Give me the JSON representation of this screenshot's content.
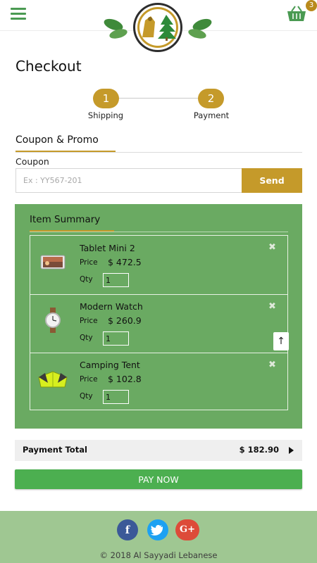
{
  "header": {
    "menu_icon": "hamburger-icon",
    "logo_icon": "al-sayyadi-logo",
    "cart_icon": "basket-icon",
    "cart_count": "3"
  },
  "page": {
    "title": "Checkout"
  },
  "steps": [
    {
      "number": "1",
      "label": "Shipping"
    },
    {
      "number": "2",
      "label": "Payment"
    }
  ],
  "coupon_section": {
    "title": "Coupon & Promo",
    "label": "Coupon",
    "placeholder": "Ex : YY567-201",
    "value": "",
    "send_label": "Send"
  },
  "summary": {
    "title": "Item Summary",
    "price_label": "Price",
    "qty_label": "Qty",
    "items": [
      {
        "name": "Tablet Mini 2",
        "price": "$ 472.5",
        "qty": "1",
        "thumb_icon": "tablet-icon"
      },
      {
        "name": "Modern Watch",
        "price": "$ 260.9",
        "qty": "1",
        "thumb_icon": "watch-icon"
      },
      {
        "name": "Camping Tent",
        "price": "$ 102.8",
        "qty": "1",
        "thumb_icon": "tent-icon"
      }
    ]
  },
  "total": {
    "label": "Payment Total",
    "value": "$ 182.90"
  },
  "pay_label": "PAY NOW",
  "footer": {
    "social": [
      {
        "name": "facebook",
        "glyph": "f",
        "color": "#3b5998"
      },
      {
        "name": "twitter",
        "glyph": "t",
        "color": "#1da1f2"
      },
      {
        "name": "google-plus",
        "glyph": "G+",
        "color": "#dd4b39"
      }
    ],
    "copyright": "© 2018 Al Sayyadi Lebanese"
  },
  "colors": {
    "accent_gold": "#c59a2a",
    "summary_green": "#6aaa62",
    "pay_green": "#4caf50",
    "footer_green": "#9fc792"
  }
}
